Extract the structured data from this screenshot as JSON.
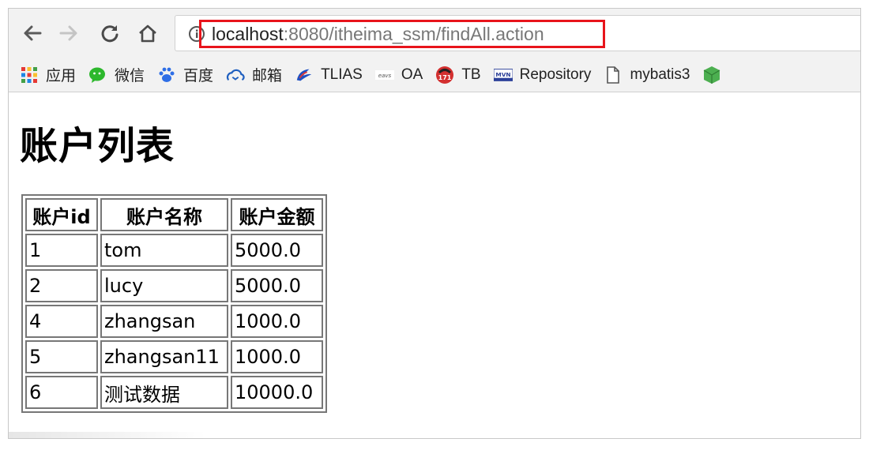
{
  "browser": {
    "url_host": "localhost",
    "url_rest": ":8080/itheima_ssm/findAll.action",
    "highlight_color": "#e8141b"
  },
  "bookmarks": [
    {
      "label": "应用",
      "icon": "apps-grid-icon"
    },
    {
      "label": "微信",
      "icon": "wechat-icon"
    },
    {
      "label": "百度",
      "icon": "baidu-paw-icon"
    },
    {
      "label": "邮箱",
      "icon": "mail-cloud-icon"
    },
    {
      "label": "TLIAS",
      "icon": "tlias-icon"
    },
    {
      "label": "OA",
      "icon": "oa-icon"
    },
    {
      "label": "TB",
      "icon": "tb-icon"
    },
    {
      "label": "Repository",
      "icon": "mvn-icon"
    },
    {
      "label": "mybatis3",
      "icon": "page-icon"
    }
  ],
  "page": {
    "title": "账户列表",
    "table": {
      "headers": [
        "账户id",
        "账户名称",
        "账户金额"
      ],
      "rows": [
        [
          "1",
          "tom",
          "5000.0"
        ],
        [
          "2",
          "lucy",
          "5000.0"
        ],
        [
          "4",
          "zhangsan",
          "1000.0"
        ],
        [
          "5",
          "zhangsan11",
          "1000.0"
        ],
        [
          "6",
          "测试数据",
          "10000.0"
        ]
      ]
    }
  }
}
